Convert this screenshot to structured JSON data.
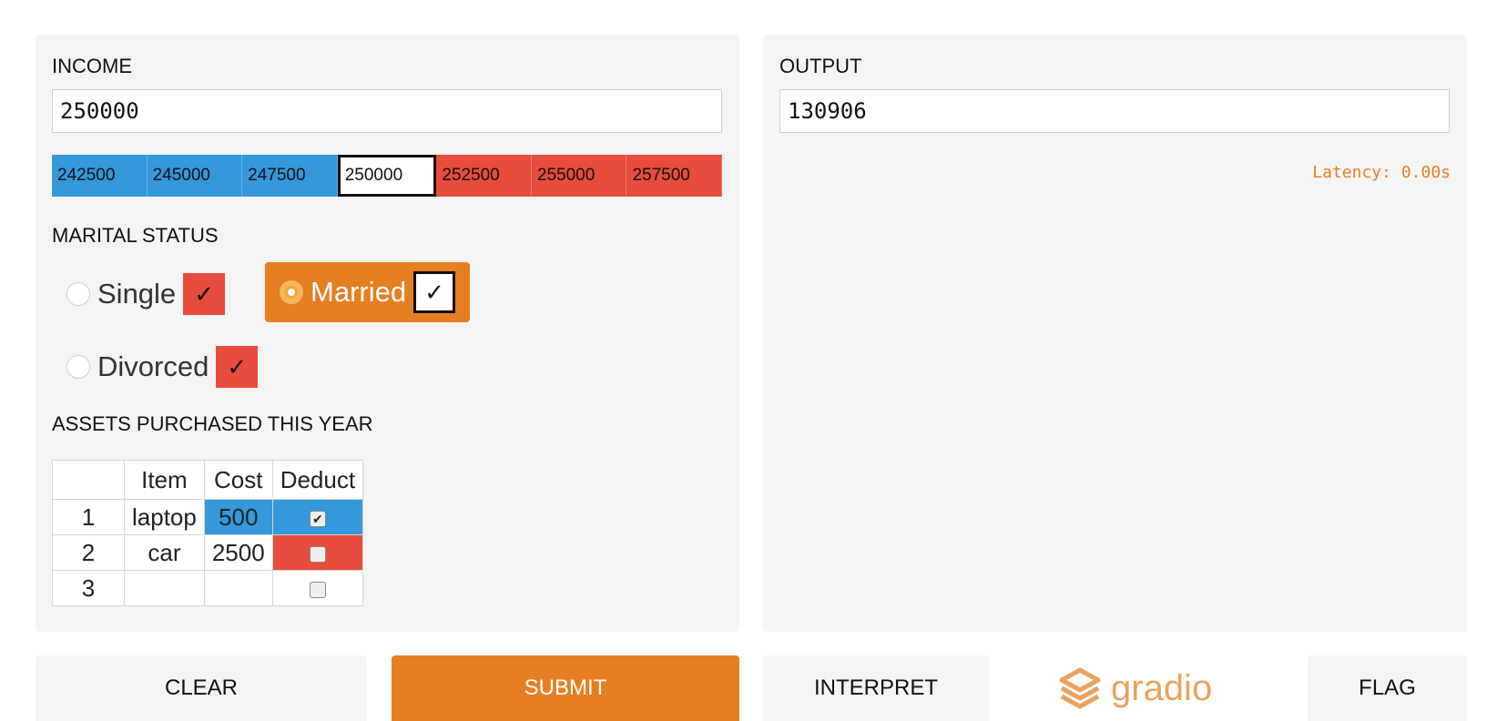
{
  "input": {
    "income_label": "INCOME",
    "income_value": "250000",
    "interpretation": [
      {
        "value": "242500",
        "color": "#3498db"
      },
      {
        "value": "245000",
        "color": "#3498db"
      },
      {
        "value": "247500",
        "color": "#3498db"
      },
      {
        "value": "250000",
        "color": "#ffffff"
      },
      {
        "value": "252500",
        "color": "#e74c3c"
      },
      {
        "value": "255000",
        "color": "#e74c3c"
      },
      {
        "value": "257500",
        "color": "#e74c3c"
      }
    ],
    "marital_label": "MARITAL STATUS",
    "marital_options": [
      {
        "label": "Single",
        "selected": false,
        "mark": "✓"
      },
      {
        "label": "Married",
        "selected": true,
        "mark": "✓"
      },
      {
        "label": "Divorced",
        "selected": false,
        "mark": "✓"
      }
    ],
    "assets_label": "ASSETS PURCHASED THIS YEAR",
    "assets_table": {
      "headers": [
        "",
        "Item",
        "Cost",
        "Deduct"
      ],
      "rows": [
        {
          "index": "1",
          "item": "laptop",
          "cost": "500",
          "deduct": true
        },
        {
          "index": "2",
          "item": "car",
          "cost": "2500",
          "deduct": false
        },
        {
          "index": "3",
          "item": "",
          "cost": "",
          "deduct": false
        }
      ]
    }
  },
  "output": {
    "label": "OUTPUT",
    "value": "130906",
    "latency": "Latency: 0.00s"
  },
  "buttons": {
    "clear": "CLEAR",
    "submit": "SUBMIT",
    "interpret": "INTERPRET",
    "flag": "FLAG"
  },
  "logo": {
    "text": "gradio",
    "icon": "gradio-logo-icon"
  },
  "colors": {
    "accent": "#e67e22",
    "negative": "#3498db",
    "positive": "#e74c3c",
    "panel": "#f4f4f4"
  }
}
